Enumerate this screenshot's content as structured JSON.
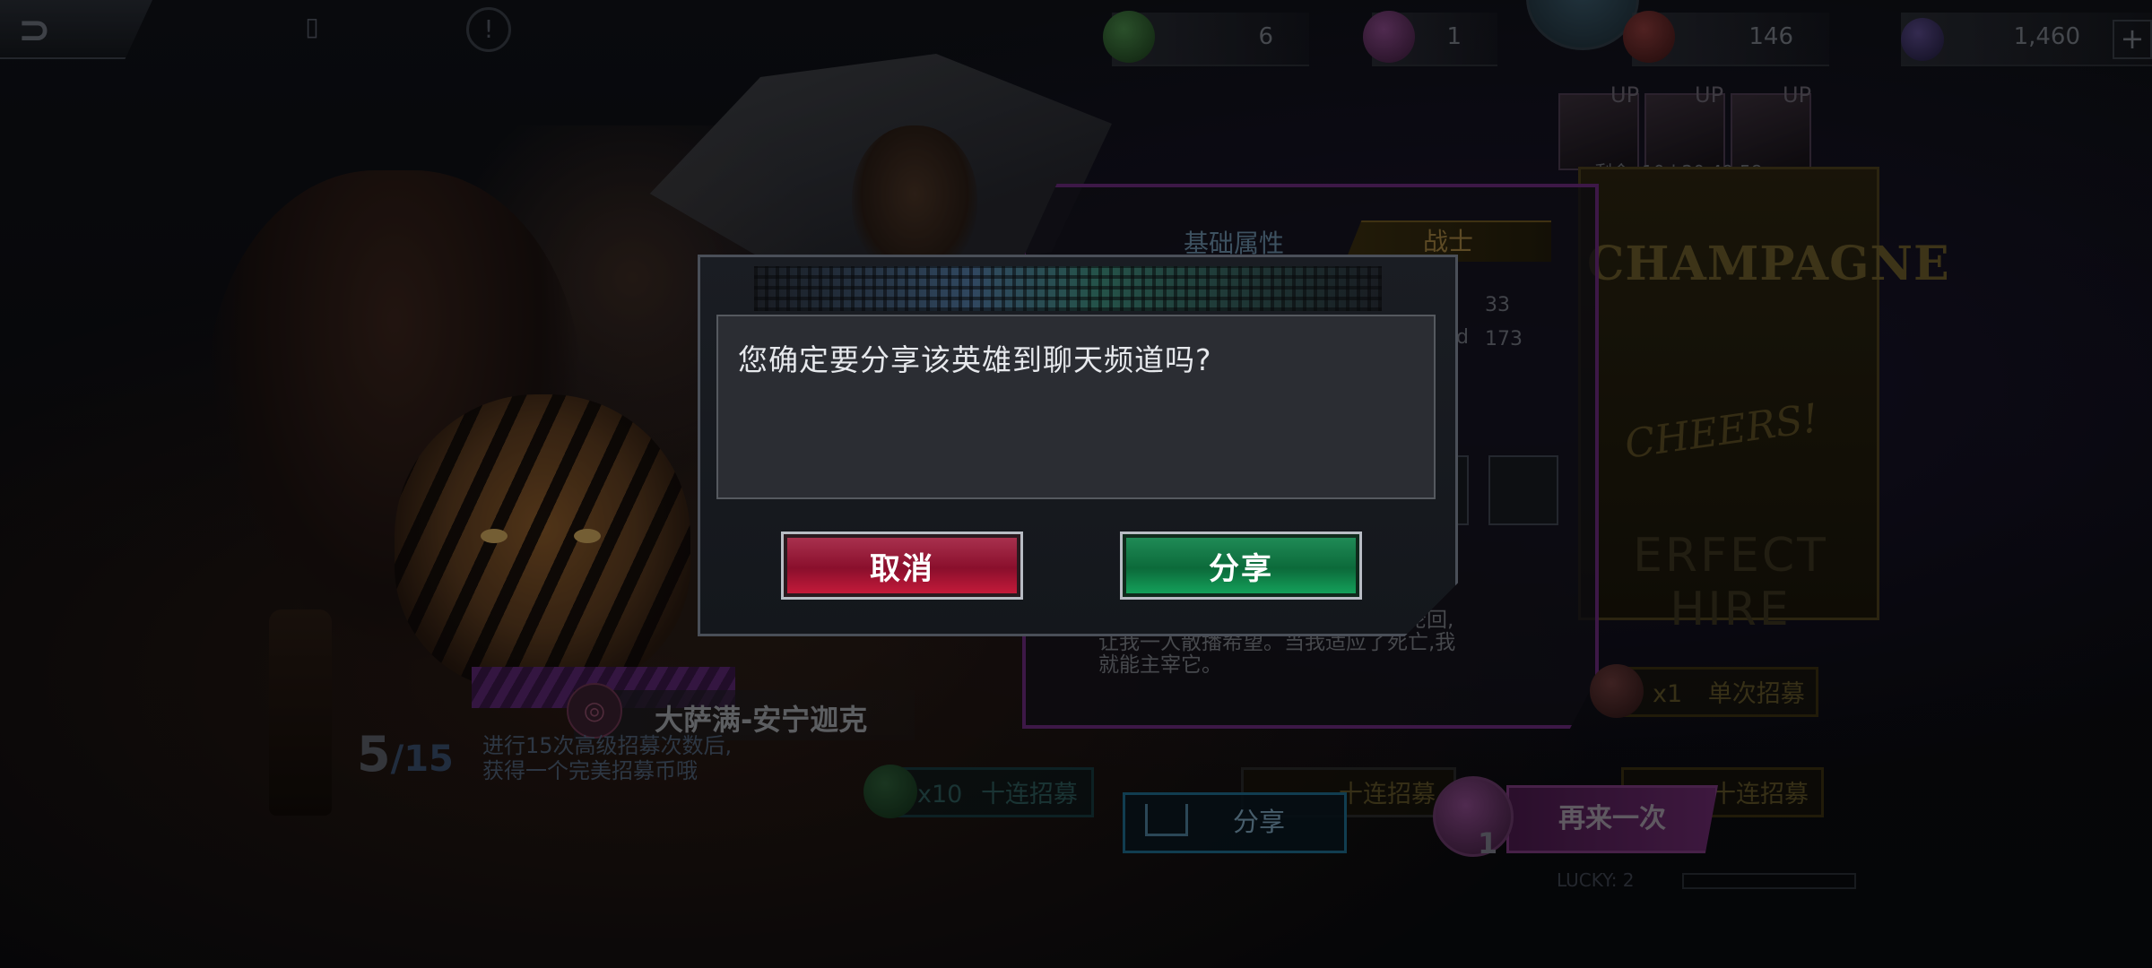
{
  "currencies": [
    {
      "value": "6",
      "color": "#2f6b3a"
    },
    {
      "value": "1",
      "color": "#6a2a6a"
    },
    {
      "value": "146",
      "color": "#7a2a2a"
    },
    {
      "value": "1,460",
      "color": "#3a2f5a"
    }
  ],
  "banner": {
    "up_labels": [
      "UP",
      "UP",
      "UP"
    ],
    "timer": "剩余: 10d 20:49:58",
    "poster_title": "CHAMPAGNE",
    "poster_cheers": "CHEERS!",
    "poster_hire": "ERFECT HIRE"
  },
  "hero": {
    "tab_basic": "基础属性",
    "tab_class": "战士",
    "stats": [
      "33",
      "173"
    ],
    "stat_label": "d",
    "lore_line1": "爱轮回,",
    "lore_line2": "让我一人散播希望。当我适应了死亡,我",
    "lore_line3": "就能主宰它。",
    "name": "大萨满-安宁迦克",
    "count_current": "5",
    "count_total": "/15",
    "quest_line1": "进行15次高级招募次数后,",
    "quest_line2": "获得一个完美招募币哦"
  },
  "actions": {
    "single_count": "x1",
    "single_label": "单次招募",
    "ten_count": "x10",
    "ten_label": "十连招募",
    "ten_label_mid": "十连招募",
    "ten_label_right": "十连招募",
    "share_label": "分享",
    "again_label": "再来一次",
    "again_cost": "1",
    "lucky": "LUCKY: 2"
  },
  "dialog": {
    "message": "您确定要分享该英雄到聊天频道吗?",
    "cancel_label": "取消",
    "confirm_label": "分享",
    "cancel_color": "#8a0f2c",
    "confirm_color": "#0c6a3a"
  }
}
